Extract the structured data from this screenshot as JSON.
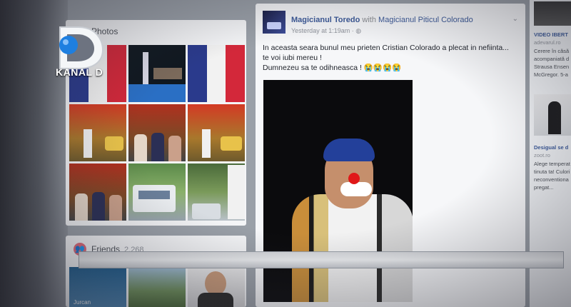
{
  "channel": {
    "name": "KANAL D"
  },
  "photos": {
    "title": "Photos"
  },
  "friends": {
    "title": "Friends",
    "count": "2,268",
    "friend_caption": "Jurcan"
  },
  "post": {
    "author": "Magicianul Toredo",
    "with_text": "with",
    "with_name": "Magicianul Piticul Colorado",
    "time": "Yesterday at 1:19am",
    "time_dot": "·",
    "text_line1": "In aceasta seara bunul meu prieten Cristian Colorado a plecat in nefiinta...",
    "text_line2": "te voi iubi mereu !",
    "text_line3": "Dumnezeu sa te odihneasca !",
    "emojis": "😭😭😭😭"
  },
  "right_column": {
    "item1_title": "VIDEO IBERT",
    "item1_source": "adevarul.ro",
    "item1_lines": [
      "Cerere în căsă",
      "acompaniată d",
      "Strausa Ensen",
      "McGregor. 5-a"
    ],
    "item2_title": "Desigual se d",
    "item2_source": "zoot.ro",
    "item2_lines": [
      "Alege temperat",
      "tinuta ta! Culori",
      "neconventiona",
      "pregat..."
    ]
  },
  "colors": {
    "link": "#3b5998",
    "text": "#1d2129",
    "card_bg": "#f6f7f9",
    "logo_blue": "#1e7fe0"
  }
}
